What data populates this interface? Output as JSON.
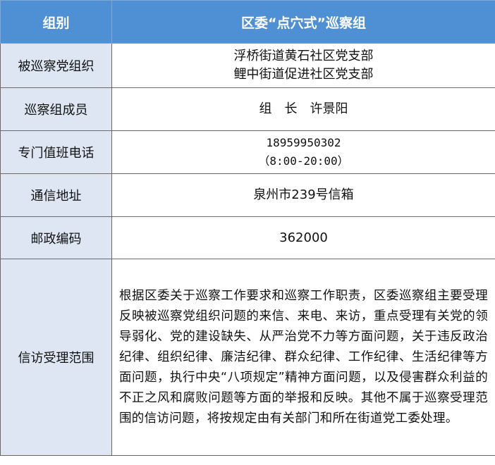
{
  "header": {
    "col1": "组别",
    "col2": "区委“点穴式”巡察组"
  },
  "rows": {
    "org": {
      "label": "被巡察党组织",
      "lines": [
        "浮桥街道黄石社区党支部",
        "鲤中街道促进社区党支部"
      ]
    },
    "members": {
      "label": "巡察组成员",
      "value": "组　长　许景阳"
    },
    "phone": {
      "label": "专门值班电话",
      "number": "18959950302",
      "hours": "（8:00-20:00）"
    },
    "address": {
      "label": "通信地址",
      "value": "泉州市239号信箱"
    },
    "postcode": {
      "label": "邮政编码",
      "value": "362000"
    },
    "scope": {
      "label": "信访受理范围",
      "text": "根据区委关于巡察工作要求和巡察工作职责，区委巡察组主要受理反映被巡察党组织问题的来信、来电、来访，重点受理有关党的领导弱化、党的建设缺失、从严治党不力等方面问题，关于违反政治纪律、组织纪律、廉洁纪律、群众纪律、工作纪律、生活纪律等方面问题，执行中央“八项规定”精神方面问题，以及侵害群众利益的不正之风和腐败问题等方面的举报和反映。其他不属于巡察受理范围的信访问题，将按规定由有关部门和所在街道党工委处理。"
    }
  },
  "colors": {
    "header_bg": "#4e90d3",
    "label_bg": "#dde6f2",
    "border": "#6a6a6a"
  }
}
